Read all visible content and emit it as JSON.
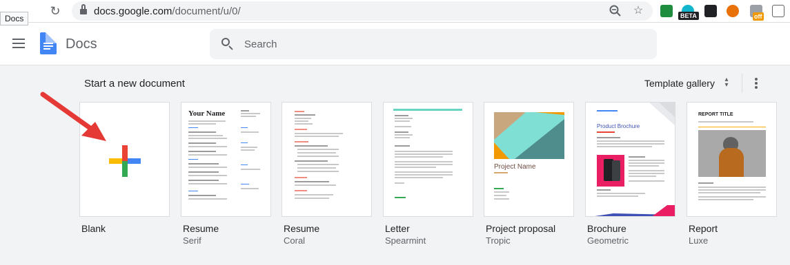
{
  "browser": {
    "tooltip": "Docs",
    "url_domain": "docs.google.com",
    "url_path": "/document/u/0/",
    "beta_badge": "BETA",
    "off_badge": "off",
    "icons": [
      "back-icon",
      "reload-icon",
      "lock-icon",
      "zoom-icon",
      "star-icon"
    ]
  },
  "header": {
    "app_title": "Docs",
    "search_placeholder": "Search"
  },
  "templates": {
    "section_title": "Start a new document",
    "gallery_label": "Template gallery",
    "items": [
      {
        "title": "Blank",
        "subtitle": ""
      },
      {
        "title": "Resume",
        "subtitle": "Serif",
        "thumb_text": "Your Name"
      },
      {
        "title": "Resume",
        "subtitle": "Coral"
      },
      {
        "title": "Letter",
        "subtitle": "Spearmint"
      },
      {
        "title": "Project proposal",
        "subtitle": "Tropic",
        "thumb_text": "Project Name"
      },
      {
        "title": "Brochure",
        "subtitle": "Geometric",
        "thumb_text": "Product Brochure"
      },
      {
        "title": "Report",
        "subtitle": "Luxe",
        "thumb_text": "REPORT TITLE"
      }
    ]
  },
  "colors": {
    "accent_blue": "#4285f4",
    "plus_red": "#ea4335",
    "plus_green": "#34a853",
    "plus_yellow": "#fbbc04",
    "arrow_red": "#e53935"
  }
}
